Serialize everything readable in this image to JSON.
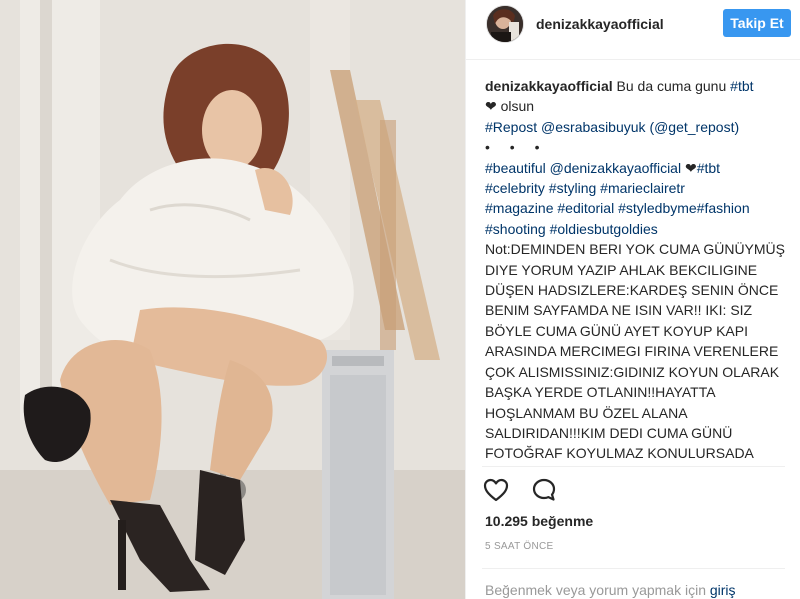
{
  "post": {
    "photo_alt": "",
    "header": {
      "username": "denizakkayaofficial",
      "follow_label": "Takip Et"
    },
    "caption": {
      "username": "denizakkayaofficial",
      "line1_text": " Bu da cuma gunu ",
      "line1_tag": "#tbt",
      "line2": "❤ olsun",
      "repost_tag": "#Repost",
      "repost_mention": "@esrabasibuyuk",
      "repost_source": "(@get_repost)",
      "dots": "• • •",
      "tags_a": "#beautiful @denizakkayaofficial",
      "heart": " ❤",
      "tags_b": "#tbt",
      "tags_line2": "#celebrity #styling #marieclairetr",
      "tags_line3": "#magazine #editorial #styledbyme#fashion",
      "tags_line4": "#shooting #oldiesbutgoldies",
      "note": "Not:DEMINDEN BERI YOK CUMA GÜNÜYMÜŞ DIYE YORUM YAZIP AHLAK BEKCILIGINE DÜŞEN HADSIZLERE:KARDEŞ SENIN ÖNCE BENIM SAYFAMDA NE ISIN VAR!! IKI: SIZ BÖYLE CUMA GÜNÜ AYET KOYUP KAPI ARASINDA MERCIMEGI FIRINA VERENLERE ÇOK ALISMISSINIZ:GIDINIZ KOYUN OLARAK BAŞKA YERDE OTLANIN!!HAYATTA HOŞLANMAM BU ÖZEL ALANA SALDIRIDAN!!!KIM DEDI CUMA GÜNÜ FOTOĞRAF KOYULMAZ KONULURSADA"
    },
    "actions": {
      "like_icon": "heart-icon",
      "comment_icon": "comment-icon"
    },
    "likes": "10.295 beğenme",
    "timestamp": "5 SAAT ÖNCE",
    "footer": {
      "prompt": "Beğenmek veya yorum yapmak için ",
      "login_label": "giriş"
    }
  },
  "colors": {
    "accent": "#3897f0",
    "link": "#003569",
    "muted": "#999999",
    "text": "#262626"
  }
}
